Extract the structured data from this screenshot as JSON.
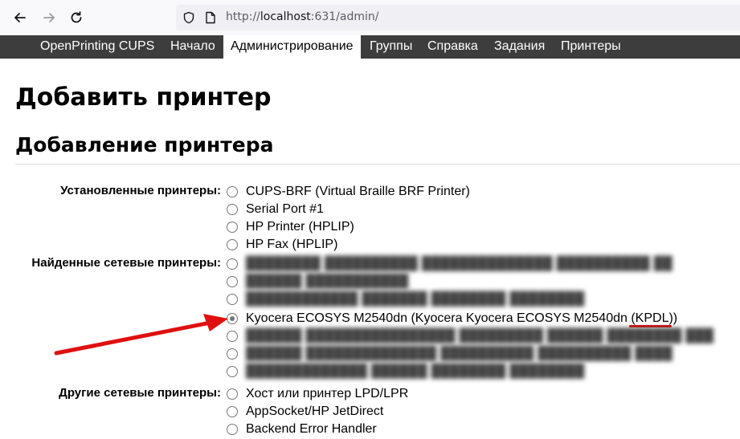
{
  "browser": {
    "url_scheme": "http://",
    "url_host": "localhost",
    "url_path": ":631/admin/"
  },
  "nav": {
    "items": [
      {
        "label": "OpenPrinting CUPS",
        "active": false
      },
      {
        "label": "Начало",
        "active": false
      },
      {
        "label": "Администрирование",
        "active": true
      },
      {
        "label": "Группы",
        "active": false
      },
      {
        "label": "Справка",
        "active": false
      },
      {
        "label": "Задания",
        "active": false
      },
      {
        "label": "Принтеры",
        "active": false
      }
    ]
  },
  "page": {
    "title": "Добавить принтер",
    "section_title": "Добавление принтера"
  },
  "groups": {
    "installed": {
      "label": "Установленные принтеры:",
      "options": [
        "CUPS-BRF (Virtual Braille BRF Printer)",
        "Serial Port #1",
        "HP Printer (HPLIP)",
        "HP Fax (HPLIP)"
      ]
    },
    "discovered": {
      "label": "Найденные сетевые принтеры:",
      "options": [
        {
          "text": "",
          "blurred": true,
          "checked": false
        },
        {
          "text": "",
          "blurred": true,
          "checked": false
        },
        {
          "text": "",
          "blurred": true,
          "checked": false
        },
        {
          "text": "Kyocera ECOSYS M2540dn (Kyocera Kyocera ECOSYS M2540dn ",
          "highlight": "(KPDL)",
          "suffix": ")",
          "blurred": false,
          "checked": true
        },
        {
          "text": "",
          "blurred": true,
          "checked": false
        },
        {
          "text": "",
          "blurred": true,
          "checked": false
        },
        {
          "text": "",
          "blurred": true,
          "checked": false
        }
      ]
    },
    "other": {
      "label": "Другие сетевые принтеры:",
      "options": [
        "Хост или принтер LPD/LPR",
        "AppSocket/HP JetDirect",
        "Backend Error Handler"
      ]
    }
  },
  "colors": {
    "navbar": "#3d3d3d",
    "annotation": "#e01010"
  }
}
